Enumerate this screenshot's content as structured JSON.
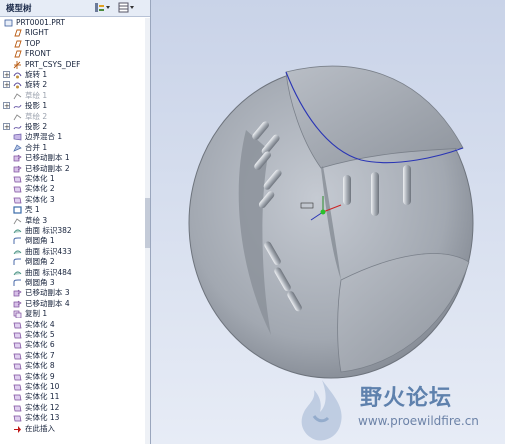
{
  "tree_panel": {
    "title": "模型树",
    "show_button_icon": "tree-settings-icon",
    "view_button_icon": "tree-columns-icon"
  },
  "tree": {
    "items": [
      {
        "label": "PRT0001.PRT",
        "icon": "part-icon",
        "expandable": false,
        "dimmed": false
      },
      {
        "label": "RIGHT",
        "icon": "datum-plane-icon",
        "expandable": false,
        "dimmed": false
      },
      {
        "label": "TOP",
        "icon": "datum-plane-icon",
        "expandable": false,
        "dimmed": false
      },
      {
        "label": "FRONT",
        "icon": "datum-plane-icon",
        "expandable": false,
        "dimmed": false
      },
      {
        "label": "PRT_CSYS_DEF",
        "icon": "csys-icon",
        "expandable": false,
        "dimmed": false
      },
      {
        "label": "旋转 1",
        "icon": "revolve-icon",
        "expandable": true,
        "dimmed": false
      },
      {
        "label": "旋转 2",
        "icon": "revolve-icon",
        "expandable": true,
        "dimmed": false
      },
      {
        "label": "草绘 1",
        "icon": "sketch-icon",
        "expandable": false,
        "dimmed": true
      },
      {
        "label": "投影 1",
        "icon": "project-curve-icon",
        "expandable": true,
        "dimmed": false
      },
      {
        "label": "草绘 2",
        "icon": "sketch-icon",
        "expandable": false,
        "dimmed": true
      },
      {
        "label": "投影 2",
        "icon": "project-curve-icon",
        "expandable": true,
        "dimmed": false
      },
      {
        "label": "边界混合 1",
        "icon": "boundary-blend-icon",
        "expandable": false,
        "dimmed": false
      },
      {
        "label": "合并 1",
        "icon": "merge-icon",
        "expandable": false,
        "dimmed": false
      },
      {
        "label": "已移动副本 1",
        "icon": "moved-copy-icon",
        "expandable": false,
        "dimmed": false
      },
      {
        "label": "已移动副本 2",
        "icon": "moved-copy-icon",
        "expandable": false,
        "dimmed": false
      },
      {
        "label": "实体化 1",
        "icon": "solidify-icon",
        "expandable": false,
        "dimmed": false
      },
      {
        "label": "实体化 2",
        "icon": "solidify-icon",
        "expandable": false,
        "dimmed": false
      },
      {
        "label": "实体化 3",
        "icon": "solidify-icon",
        "expandable": false,
        "dimmed": false
      },
      {
        "label": "壳 1",
        "icon": "shell-icon",
        "expandable": false,
        "dimmed": false
      },
      {
        "label": "草绘 3",
        "icon": "sketch-icon",
        "expandable": false,
        "dimmed": false
      },
      {
        "label": "曲面 标识382",
        "icon": "surface-icon",
        "expandable": false,
        "dimmed": false
      },
      {
        "label": "倒圆角 1",
        "icon": "round-icon",
        "expandable": false,
        "dimmed": false
      },
      {
        "label": "曲面 标识433",
        "icon": "surface-icon",
        "expandable": false,
        "dimmed": false
      },
      {
        "label": "倒圆角 2",
        "icon": "round-icon",
        "expandable": false,
        "dimmed": false
      },
      {
        "label": "曲面 标识484",
        "icon": "surface-icon",
        "expandable": false,
        "dimmed": false
      },
      {
        "label": "倒圆角 3",
        "icon": "round-icon",
        "expandable": false,
        "dimmed": false
      },
      {
        "label": "已移动副本 3",
        "icon": "moved-copy-icon",
        "expandable": false,
        "dimmed": false
      },
      {
        "label": "已移动副本 4",
        "icon": "moved-copy-icon",
        "expandable": false,
        "dimmed": false
      },
      {
        "label": "复制 1",
        "icon": "copy-icon",
        "expandable": false,
        "dimmed": false
      },
      {
        "label": "实体化 4",
        "icon": "solidify-icon",
        "expandable": false,
        "dimmed": false
      },
      {
        "label": "实体化 5",
        "icon": "solidify-icon",
        "expandable": false,
        "dimmed": false
      },
      {
        "label": "实体化 6",
        "icon": "solidify-icon",
        "expandable": false,
        "dimmed": false
      },
      {
        "label": "实体化 7",
        "icon": "solidify-icon",
        "expandable": false,
        "dimmed": false
      },
      {
        "label": "实体化 8",
        "icon": "solidify-icon",
        "expandable": false,
        "dimmed": false
      },
      {
        "label": "实体化 9",
        "icon": "solidify-icon",
        "expandable": false,
        "dimmed": false
      },
      {
        "label": "实体化 10",
        "icon": "solidify-icon",
        "expandable": false,
        "dimmed": false
      },
      {
        "label": "实体化 11",
        "icon": "solidify-icon",
        "expandable": false,
        "dimmed": false
      },
      {
        "label": "实体化 12",
        "icon": "solidify-icon",
        "expandable": false,
        "dimmed": false
      },
      {
        "label": "实体化 13",
        "icon": "solidify-icon",
        "expandable": false,
        "dimmed": false
      },
      {
        "label": "在此插入",
        "icon": "insert-here-arrow-icon",
        "expandable": false,
        "dimmed": false
      }
    ]
  },
  "watermark": {
    "title": "野火论坛",
    "url": "www.proewildfire.cn"
  },
  "colors": {
    "viewport_top": "#c9d3e8",
    "viewport_bottom": "#e7ecf6",
    "model_body": "#a4aab3",
    "curve_blue": "#2a35b5"
  }
}
